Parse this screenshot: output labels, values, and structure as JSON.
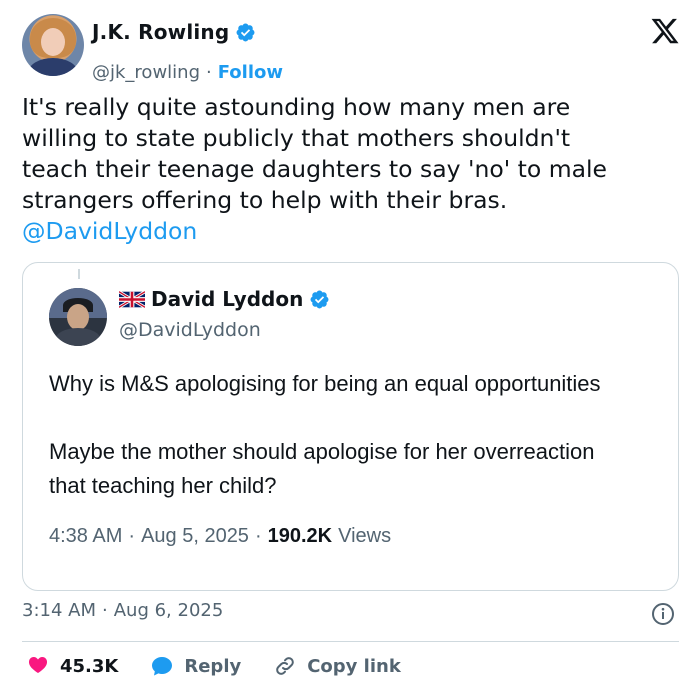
{
  "author": {
    "name": "J.K. Rowling",
    "handle": "@jk_rowling",
    "separator": "·",
    "follow_label": "Follow"
  },
  "tweet": {
    "lines": [
      "It's really quite astounding how many men are",
      "willing to state publicly that mothers shouldn't",
      "teach their teenage daughters to say 'no' to male",
      "strangers offering to help with their bras."
    ],
    "mention": "@DavidLyddon"
  },
  "quoted": {
    "name": "David Lyddon",
    "handle": "@DavidLyddon",
    "para1": "Why is M&S apologising for being an equal opportunities",
    "para2_lines": [
      "Maybe the mother should apologise for her overreaction",
      "that teaching her child?"
    ],
    "time": "4:38 AM",
    "separator": "·",
    "date": "Aug 5, 2025",
    "views_count": "190.2K",
    "views_label": "Views"
  },
  "timestamp": {
    "time": "3:14 AM",
    "separator": "·",
    "date": "Aug 6, 2025"
  },
  "actions": {
    "likes": "45.3K",
    "reply_label": "Reply",
    "copy_link_label": "Copy link"
  },
  "colors": {
    "accent": "#1d9bf0",
    "like": "#f91880",
    "muted": "#536471",
    "border": "#cfd9de"
  },
  "icons": {
    "verified": "verified-badge-icon",
    "x_logo": "x-logo-icon",
    "flag": "uk-flag-icon",
    "info": "info-icon",
    "heart": "heart-icon",
    "reply": "reply-bubble-icon",
    "link": "link-icon"
  }
}
